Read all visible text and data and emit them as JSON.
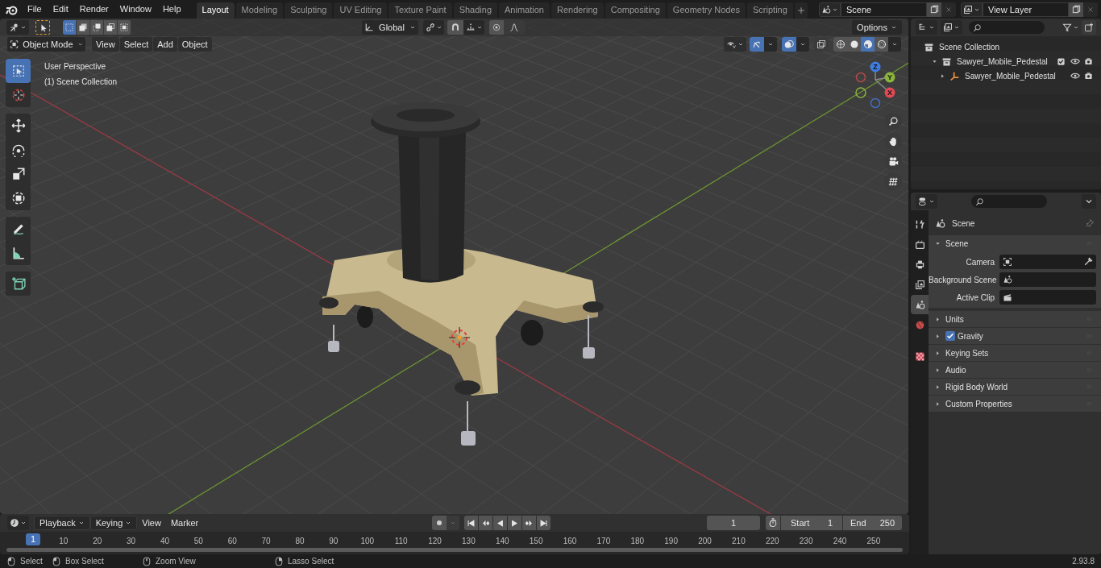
{
  "menu": [
    "File",
    "Edit",
    "Render",
    "Window",
    "Help"
  ],
  "workspaces": [
    {
      "label": "Layout",
      "selected": true
    },
    {
      "label": "Modeling",
      "selected": false
    },
    {
      "label": "Sculpting",
      "selected": false
    },
    {
      "label": "UV Editing",
      "selected": false
    },
    {
      "label": "Texture Paint",
      "selected": false
    },
    {
      "label": "Shading",
      "selected": false
    },
    {
      "label": "Animation",
      "selected": false
    },
    {
      "label": "Rendering",
      "selected": false
    },
    {
      "label": "Compositing",
      "selected": false
    },
    {
      "label": "Geometry Nodes",
      "selected": false
    },
    {
      "label": "Scripting",
      "selected": false
    }
  ],
  "scene_field": {
    "value": "Scene"
  },
  "view_layer_field": {
    "value": "View Layer"
  },
  "tool_header": {
    "select_modes": [
      {
        "kind": "set",
        "selected": true
      },
      {
        "kind": "extend",
        "selected": false
      },
      {
        "kind": "subtract",
        "selected": false
      },
      {
        "kind": "difference",
        "selected": false
      },
      {
        "kind": "intersect",
        "selected": false
      }
    ],
    "orientation": "Global",
    "options": "Options"
  },
  "viewport_header": {
    "mode": "Object Mode",
    "menus": [
      "View",
      "Select",
      "Add",
      "Object"
    ],
    "toggles": [
      {
        "kind": "gizmo",
        "on": true
      },
      {
        "kind": "overlay",
        "on": true
      },
      {
        "kind": "xray",
        "on": false
      }
    ],
    "shading": [
      {
        "kind": "wireframe",
        "selected": false
      },
      {
        "kind": "solid",
        "selected": false
      },
      {
        "kind": "material",
        "selected": true
      },
      {
        "kind": "rendered",
        "selected": false
      }
    ]
  },
  "viewport": {
    "info": [
      "User Perspective",
      "(1) Scene Collection"
    ],
    "gizmo_axes": [
      {
        "label": "Z"
      },
      {
        "label": "Y"
      },
      {
        "label": "X"
      }
    ],
    "tool_groups": [
      [
        {
          "kind": "select",
          "selected": true
        },
        {
          "kind": "cursor",
          "selected": false
        }
      ],
      [
        {
          "kind": "move",
          "selected": false
        },
        {
          "kind": "rotate",
          "selected": false
        },
        {
          "kind": "scale",
          "selected": false
        },
        {
          "kind": "transform",
          "selected": false
        }
      ],
      [
        {
          "kind": "annotate",
          "selected": false
        },
        {
          "kind": "measure",
          "selected": false
        }
      ],
      [
        {
          "kind": "add-cube",
          "selected": false
        }
      ]
    ]
  },
  "outliner": {
    "items": [
      {
        "label": "Scene Collection",
        "kind": "scene",
        "children": [
          {
            "label": "Sawyer_Mobile_Pedestal",
            "kind": "collection",
            "expanded": true,
            "checked": true,
            "children": [
              {
                "label": "Sawyer_Mobile_Pedestal",
                "kind": "object",
                "expanded": false
              }
            ]
          }
        ]
      }
    ]
  },
  "properties": {
    "tab_groups": [
      [
        {
          "kind": "tool",
          "selected": false
        },
        {
          "kind": "render",
          "selected": false
        },
        {
          "kind": "output",
          "selected": false
        },
        {
          "kind": "view-layer",
          "selected": false
        },
        {
          "kind": "scene",
          "selected": true
        },
        {
          "kind": "world",
          "selected": false
        }
      ],
      [
        {
          "kind": "texture",
          "selected": false
        }
      ]
    ],
    "context": "Scene",
    "panel": {
      "title": "Scene",
      "expanded": true,
      "fields": [
        {
          "label": "Camera",
          "kind": "object"
        },
        {
          "label": "Background Scene",
          "kind": "scene"
        },
        {
          "label": "Active Clip",
          "kind": "clip"
        }
      ]
    },
    "subpanels": [
      {
        "label": "Units",
        "kind": "plain"
      },
      {
        "label": "Gravity",
        "kind": "checkbox",
        "checked": true
      },
      {
        "label": "Keying Sets",
        "kind": "plain"
      },
      {
        "label": "Audio",
        "kind": "plain"
      },
      {
        "label": "Rigid Body World",
        "kind": "plain"
      },
      {
        "label": "Custom Properties",
        "kind": "plain"
      }
    ]
  },
  "timeline": {
    "menus": [
      "Playback",
      "Keying",
      "View",
      "Marker"
    ],
    "current_frame": "1",
    "start_label": "Start",
    "start": "1",
    "end_label": "End",
    "end": "250",
    "playhead": "1",
    "ticks": [
      "10",
      "20",
      "30",
      "40",
      "50",
      "60",
      "70",
      "80",
      "90",
      "100",
      "110",
      "120",
      "130",
      "140",
      "150",
      "160",
      "170",
      "180",
      "190",
      "200",
      "210",
      "220",
      "230",
      "240",
      "250"
    ]
  },
  "status_bar": {
    "hints": [
      {
        "label": "Select",
        "kind": "left"
      },
      {
        "label": "Box Select",
        "kind": "left-drag"
      },
      {
        "label": "Zoom View",
        "kind": "middle"
      },
      {
        "label": "Lasso Select",
        "kind": "right-drag"
      }
    ],
    "version": "2.93.8"
  }
}
